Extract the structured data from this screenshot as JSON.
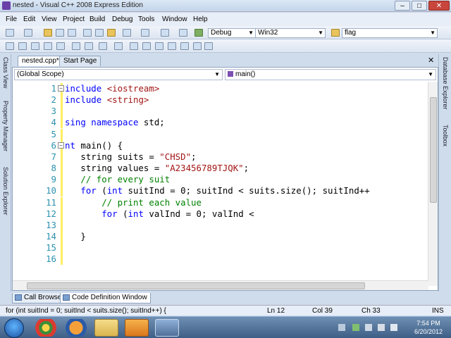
{
  "window": {
    "title": "nested - Visual C++ 2008 Express Edition",
    "controls": {
      "minimize": "–",
      "maximize": "□",
      "close": "✕"
    }
  },
  "menu": [
    "File",
    "Edit",
    "View",
    "Project",
    "Build",
    "Debug",
    "Tools",
    "Window",
    "Help"
  ],
  "toolbar": {
    "config": "Debug",
    "platform": "Win32",
    "find": "flag"
  },
  "tabs": [
    {
      "label": "nested.cpp*",
      "active": true
    },
    {
      "label": "Start Page",
      "active": false
    }
  ],
  "tab_close": "✕",
  "left_sidebar": [
    "Class View",
    "Property Manager",
    "Solution Explorer"
  ],
  "right_sidebar": [
    "Database Explorer",
    "Toolbox"
  ],
  "scope_combo": "(Global Scope)",
  "member_combo": "main()",
  "code_lines": [
    {
      "num": "1",
      "fold": "−",
      "segments": [
        {
          "t": "include ",
          "c": "kw"
        },
        {
          "t": "<iostream>",
          "c": "str"
        }
      ]
    },
    {
      "num": "2",
      "fold": "",
      "segments": [
        {
          "t": "include ",
          "c": "kw"
        },
        {
          "t": "<string>",
          "c": "str"
        }
      ]
    },
    {
      "num": "3",
      "fold": "",
      "segments": []
    },
    {
      "num": "4",
      "fold": "",
      "segments": [
        {
          "t": "sing namespace ",
          "c": "kw"
        },
        {
          "t": "std;",
          "c": ""
        }
      ]
    },
    {
      "num": "5",
      "fold": "",
      "segments": []
    },
    {
      "num": "6",
      "fold": "−",
      "segments": [
        {
          "t": "nt ",
          "c": "kw"
        },
        {
          "t": "main() {",
          "c": ""
        }
      ]
    },
    {
      "num": "7",
      "fold": "",
      "segments": [
        {
          "t": "   string suits = ",
          "c": ""
        },
        {
          "t": "\"CHSD\"",
          "c": "str"
        },
        {
          "t": ";",
          "c": ""
        }
      ]
    },
    {
      "num": "8",
      "fold": "",
      "segments": [
        {
          "t": "   string values = ",
          "c": ""
        },
        {
          "t": "\"A23456789TJQK\"",
          "c": "str"
        },
        {
          "t": ";",
          "c": ""
        }
      ]
    },
    {
      "num": "9",
      "fold": "",
      "segments": [
        {
          "t": "   // for every suit",
          "c": "cm"
        }
      ]
    },
    {
      "num": "10",
      "fold": "",
      "segments": [
        {
          "t": "   ",
          "c": ""
        },
        {
          "t": "for",
          "c": "kw"
        },
        {
          "t": " (",
          "c": ""
        },
        {
          "t": "int",
          "c": "kw"
        },
        {
          "t": " suitInd = 0; suitInd < suits.size(); suitInd++",
          "c": ""
        }
      ]
    },
    {
      "num": "11",
      "fold": "",
      "segments": [
        {
          "t": "       // print each value",
          "c": "cm"
        }
      ]
    },
    {
      "num": "12",
      "fold": "",
      "segments": [
        {
          "t": "       ",
          "c": ""
        },
        {
          "t": "for",
          "c": "kw"
        },
        {
          "t": " (",
          "c": ""
        },
        {
          "t": "int",
          "c": "kw"
        },
        {
          "t": " valInd = 0; valInd <",
          "c": ""
        }
      ]
    },
    {
      "num": "13",
      "fold": "",
      "segments": []
    },
    {
      "num": "14",
      "fold": "",
      "segments": [
        {
          "t": "   }",
          "c": ""
        }
      ]
    },
    {
      "num": "15",
      "fold": "",
      "segments": []
    },
    {
      "num": "16",
      "fold": "",
      "segments": []
    }
  ],
  "bottom_tabs": [
    {
      "label": "Call Browser",
      "active": false
    },
    {
      "label": "Code Definition Window",
      "active": true
    }
  ],
  "status": {
    "message": "for (int suitInd = 0; suitInd < suits.size(); suitInd++) {",
    "line": "Ln 12",
    "col": "Col 39",
    "ch": "Ch 33",
    "mode": "INS"
  },
  "taskbar": {
    "time": "7:54 PM",
    "date": "6/20/2012"
  },
  "colors": {
    "keyword": "#0000ff",
    "string": "#a31515",
    "comment": "#008000",
    "line_number": "#2b91af"
  }
}
